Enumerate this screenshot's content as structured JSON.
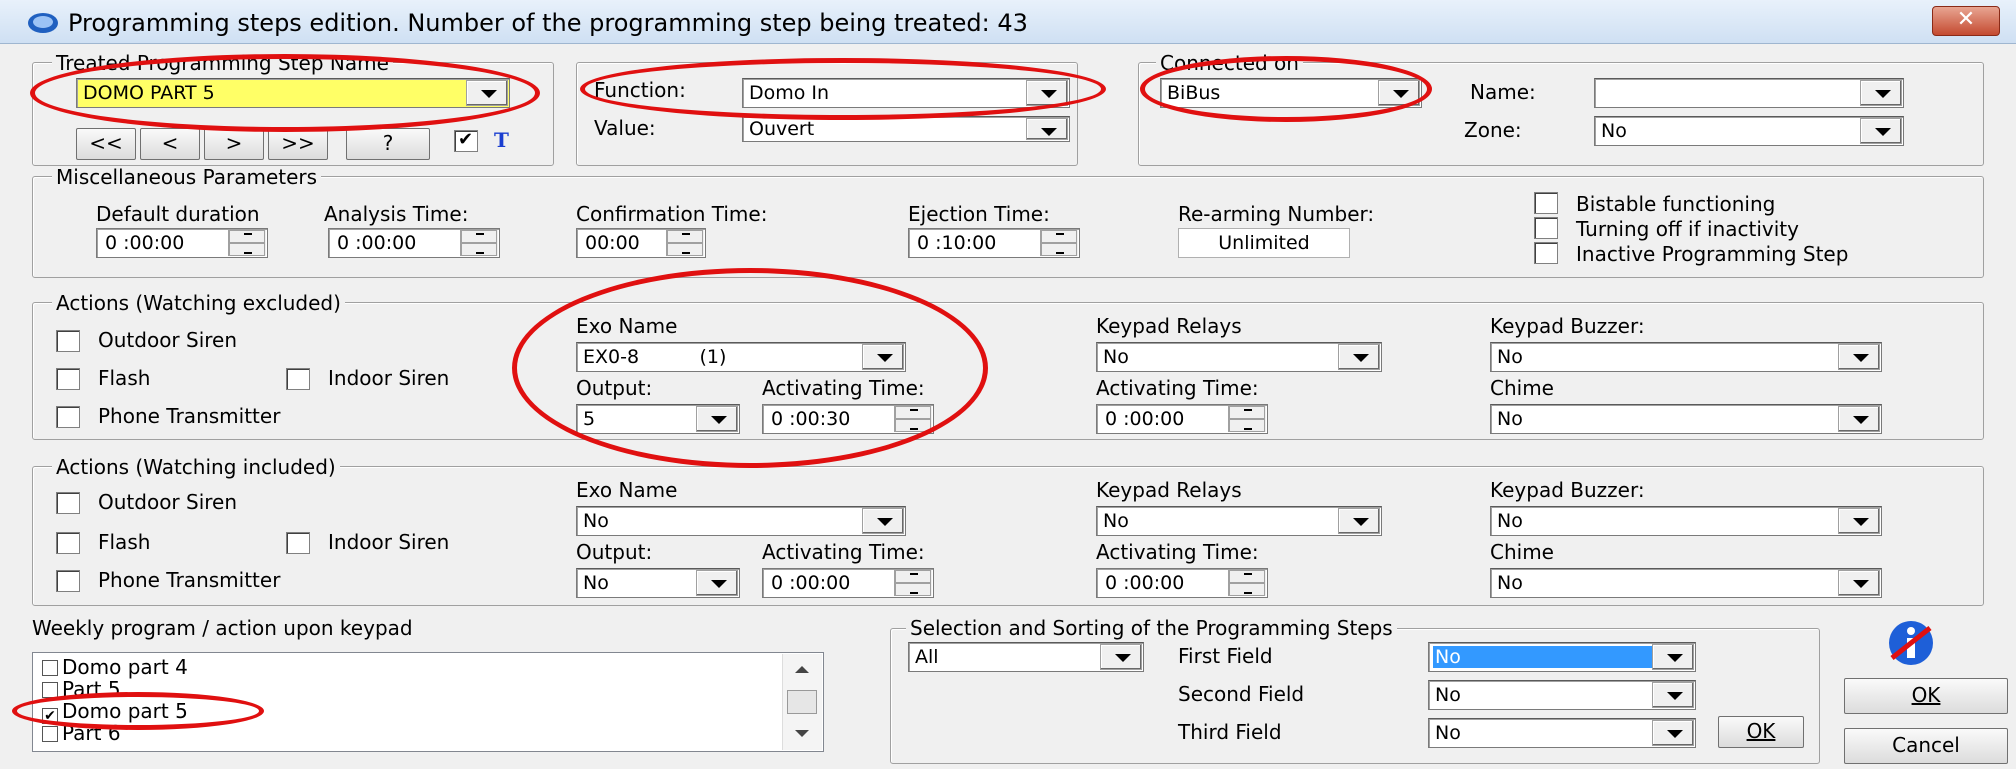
{
  "window": {
    "title": "Programming steps edition.  Number of the programming step being treated: 43",
    "close_label": "✕"
  },
  "step_name": {
    "legend": "Treated Programming Step Name",
    "value": "DOMO PART 5",
    "highlight_color": "#ffff66",
    "nav_buttons": [
      "<<",
      "<",
      ">",
      ">>",
      "?"
    ],
    "t_label": "T"
  },
  "function_group": {
    "function_label": "Function:",
    "function_value": "Domo In",
    "value_label": "Value:",
    "value_value": "Ouvert"
  },
  "connected": {
    "legend": "Connected on",
    "bus_value": "BiBus",
    "name_label": "Name:",
    "name_value": "",
    "zone_label": "Zone:",
    "zone_value": "No"
  },
  "misc": {
    "legend": "Miscellaneous Parameters",
    "default_duration_label": "Default duration",
    "default_duration": "0 :00:00",
    "analysis_label": "Analysis Time:",
    "analysis": "0 :00:00",
    "confirmation_label": "Confirmation Time:",
    "confirmation": "00:00",
    "ejection_label": "Ejection Time:",
    "ejection": "0 :10:00",
    "rearm_label": "Re-arming Number:",
    "rearm_value": "Unlimited",
    "bistable_label": "Bistable functioning",
    "turning_off_label": "Turning off if inactivity",
    "inactive_label": "Inactive Programming Step"
  },
  "actions_excluded": {
    "legend": "Actions (Watching excluded)",
    "outdoor_siren": "Outdoor Siren",
    "flash": "Flash",
    "indoor_siren": "Indoor Siren",
    "phone_transmitter": "Phone Transmitter",
    "exo_name_label": "Exo Name",
    "exo_name_value": "EX0-8          (1)",
    "output_label": "Output:",
    "output_value": "5",
    "activating_label": "Activating Time:",
    "activating_value": "0 :00:30",
    "keypad_relays_label": "Keypad Relays",
    "keypad_relays_value": "No",
    "keypad_activating_label": "Activating Time:",
    "keypad_activating_value": "0 :00:00",
    "keypad_buzzer_label": "Keypad Buzzer:",
    "keypad_buzzer_value": "No",
    "chime_label": "Chime",
    "chime_value": "No"
  },
  "actions_included": {
    "legend": "Actions (Watching included)",
    "outdoor_siren": "Outdoor Siren",
    "flash": "Flash",
    "indoor_siren": "Indoor Siren",
    "phone_transmitter": "Phone Transmitter",
    "exo_name_label": "Exo Name",
    "exo_name_value": "No",
    "output_label": "Output:",
    "output_value": "No",
    "activating_label": "Activating Time:",
    "activating_value": "0 :00:00",
    "keypad_relays_label": "Keypad Relays",
    "keypad_relays_value": "No",
    "keypad_activating_label": "Activating Time:",
    "keypad_activating_value": "0 :00:00",
    "keypad_buzzer_label": "Keypad Buzzer:",
    "keypad_buzzer_value": "No",
    "chime_label": "Chime",
    "chime_value": "No"
  },
  "weekly": {
    "label": "Weekly program / action upon keypad",
    "items": [
      {
        "label": "Domo part 4",
        "checked": false
      },
      {
        "label": "Part 5",
        "checked": false
      },
      {
        "label": "Domo part 5",
        "checked": true
      },
      {
        "label": "Part 6",
        "checked": false
      }
    ]
  },
  "sorting": {
    "legend": "Selection and Sorting of the Programming Steps",
    "filter_value": "All",
    "first_label": "First Field",
    "first_value": "No",
    "second_label": "Second Field",
    "second_value": "No",
    "third_label": "Third Field",
    "third_value": "No",
    "ok_label": "OK"
  },
  "dialog_buttons": {
    "ok_label": "OK",
    "cancel_label": "Cancel"
  },
  "colors": {
    "annotation_ring": "#e01010",
    "selection_blue": "#3399ff"
  }
}
